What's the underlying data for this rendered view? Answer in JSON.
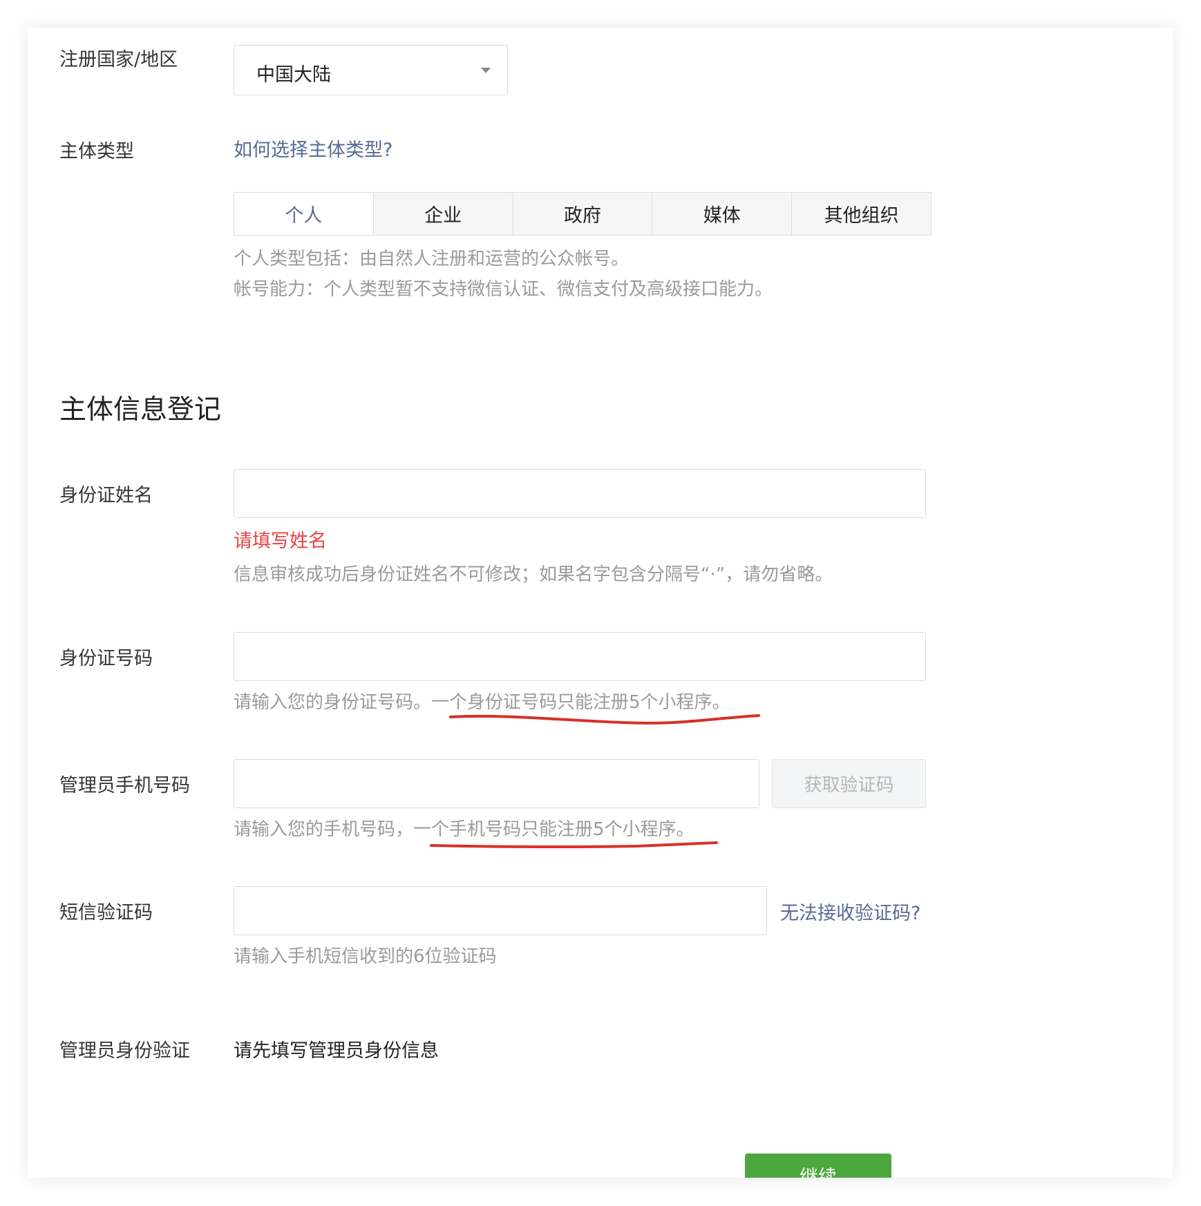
{
  "country": {
    "label": "注册国家/地区",
    "selected": "中国大陆"
  },
  "entity_type": {
    "label": "主体类型",
    "help_link": "如何选择主体类型?",
    "tabs": [
      {
        "label": "个人",
        "active": true
      },
      {
        "label": "企业",
        "active": false
      },
      {
        "label": "政府",
        "active": false
      },
      {
        "label": "媒体",
        "active": false
      },
      {
        "label": "其他组织",
        "active": false
      }
    ],
    "desc_1": "个人类型包括：由自然人注册和运营的公众帐号。",
    "desc_2": "帐号能力：个人类型暂不支持微信认证、微信支付及高级接口能力。"
  },
  "section_title": "主体信息登记",
  "id_name": {
    "label": "身份证姓名",
    "value": "",
    "error": "请填写姓名",
    "tip": "信息审核成功后身份证姓名不可修改；如果名字包含分隔号“·”，请勿省略。"
  },
  "id_number": {
    "label": "身份证号码",
    "value": "",
    "tip": "请输入您的身份证号码。一个身份证号码只能注册5个小程序。"
  },
  "admin_phone": {
    "label": "管理员手机号码",
    "value": "",
    "get_code_button": "获取验证码",
    "tip": "请输入您的手机号码，一个手机号码只能注册5个小程序。"
  },
  "sms_code": {
    "label": "短信验证码",
    "value": "",
    "help_link": "无法接收验证码?",
    "tip": "请输入手机短信收到的6位验证码"
  },
  "admin_verify": {
    "label": "管理员身份验证",
    "value": "请先填写管理员身份信息"
  },
  "continue_button": "继续",
  "colors": {
    "link": "#576b95",
    "error": "#e64340",
    "primary_button": "#4ca73c",
    "annotation": "#d93025"
  }
}
